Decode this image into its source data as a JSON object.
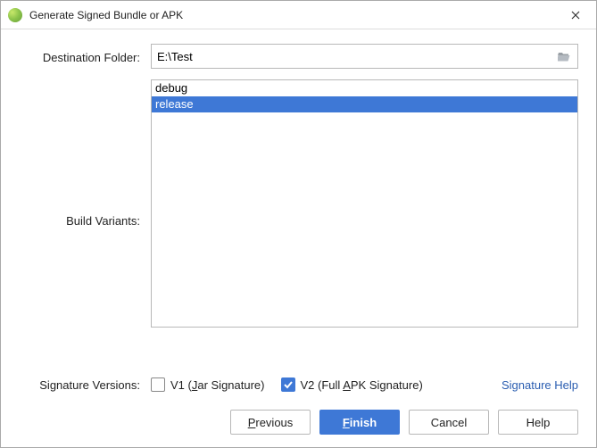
{
  "window": {
    "title": "Generate Signed Bundle or APK"
  },
  "form": {
    "destination_label": "Destination Folder:",
    "destination_value": "E:\\Test",
    "build_variants_label": "Build Variants:",
    "variants": {
      "items": [
        "debug",
        "release"
      ],
      "selected_index": 1
    }
  },
  "signature": {
    "label": "Signature Versions:",
    "v1": {
      "checked": false,
      "prefix": "V1 (",
      "mn": "J",
      "rest": "ar Signature)"
    },
    "v2": {
      "checked": true,
      "prefix": "V2 (Full ",
      "mn": "A",
      "rest": "PK Signature)"
    },
    "help_label": "Signature Help"
  },
  "buttons": {
    "previous": {
      "mn": "P",
      "rest": "revious"
    },
    "finish": {
      "mn": "F",
      "rest": "inish"
    },
    "cancel": {
      "label": "Cancel"
    },
    "help": {
      "label": "Help"
    }
  }
}
